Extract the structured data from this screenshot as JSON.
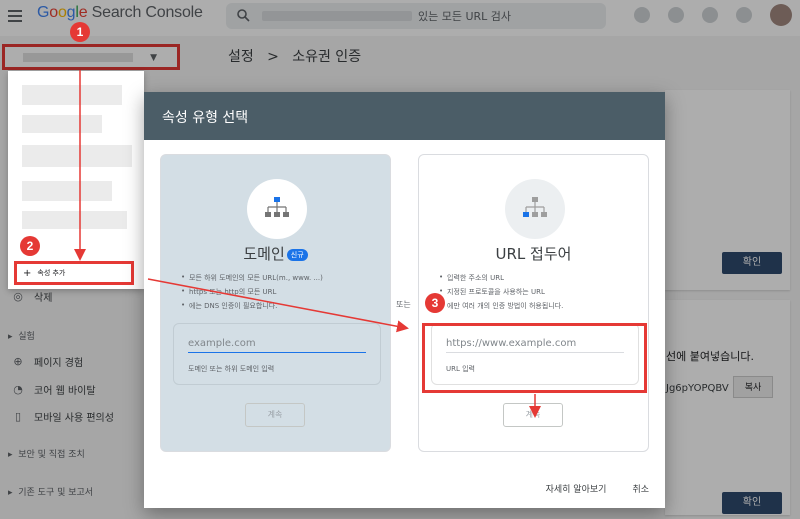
{
  "header": {
    "logo_google": "Google",
    "logo_product": "Search Console",
    "search_text": "있는 모든 URL 검사"
  },
  "breadcrumb": {
    "parent": "설정",
    "separator": ">",
    "current": "소유권 인증"
  },
  "sidebar": {
    "dropdown_add_property": "속성 추가",
    "items": [
      {
        "label": "삭제",
        "icon": "eye-off-icon"
      },
      {
        "label": "실험",
        "type": "section"
      },
      {
        "label": "페이지 경험",
        "icon": "plus-circle-icon"
      },
      {
        "label": "코어 웹 바이탈",
        "icon": "gauge-icon"
      },
      {
        "label": "모바일 사용 편의성",
        "icon": "phone-icon"
      },
      {
        "label": "보안 및 직접 조치",
        "type": "section"
      },
      {
        "label": "기존 도구 및 보고서",
        "type": "section"
      }
    ]
  },
  "background": {
    "confirm_label": "확인",
    "paste_text": "선에 붙여넣습니다.",
    "token_fragment": "Jg6pYOPQBV",
    "copy_label": "복사"
  },
  "dialog": {
    "title": "속성 유형 선택",
    "or_label": "또는",
    "domain": {
      "title": "도메인",
      "badge": "신규",
      "bullets": [
        "모든 하위 도메인의 모든 URL(m., www. ...)",
        "https 또는 http의 모든 URL",
        "에는 DNS 인증이 필요합니다."
      ],
      "input_placeholder": "example.com",
      "input_help": "도메인 또는 하위 도메인 입력",
      "continue_label": "계속"
    },
    "url_prefix": {
      "title": "URL 접두어",
      "bullets": [
        "입력한 주소의 URL",
        "지정된 프로토콜을 사용하는 URL",
        "에만 여러 개의 인증 방법이 허용됩니다."
      ],
      "input_placeholder": "https://www.example.com",
      "input_help": "URL 입력",
      "continue_label": "계속"
    },
    "footer": {
      "learn_more": "자세히 알아보기",
      "cancel": "취소"
    }
  },
  "annotations": {
    "step1": "1",
    "step2": "2",
    "step3": "3",
    "color": "#e53935"
  },
  "colors": {
    "dialog_header": "#4b5d67",
    "domain_card_bg": "#d3dee5",
    "primary_button": "#2f4a6d",
    "brand_blue": "#1a73e8"
  }
}
